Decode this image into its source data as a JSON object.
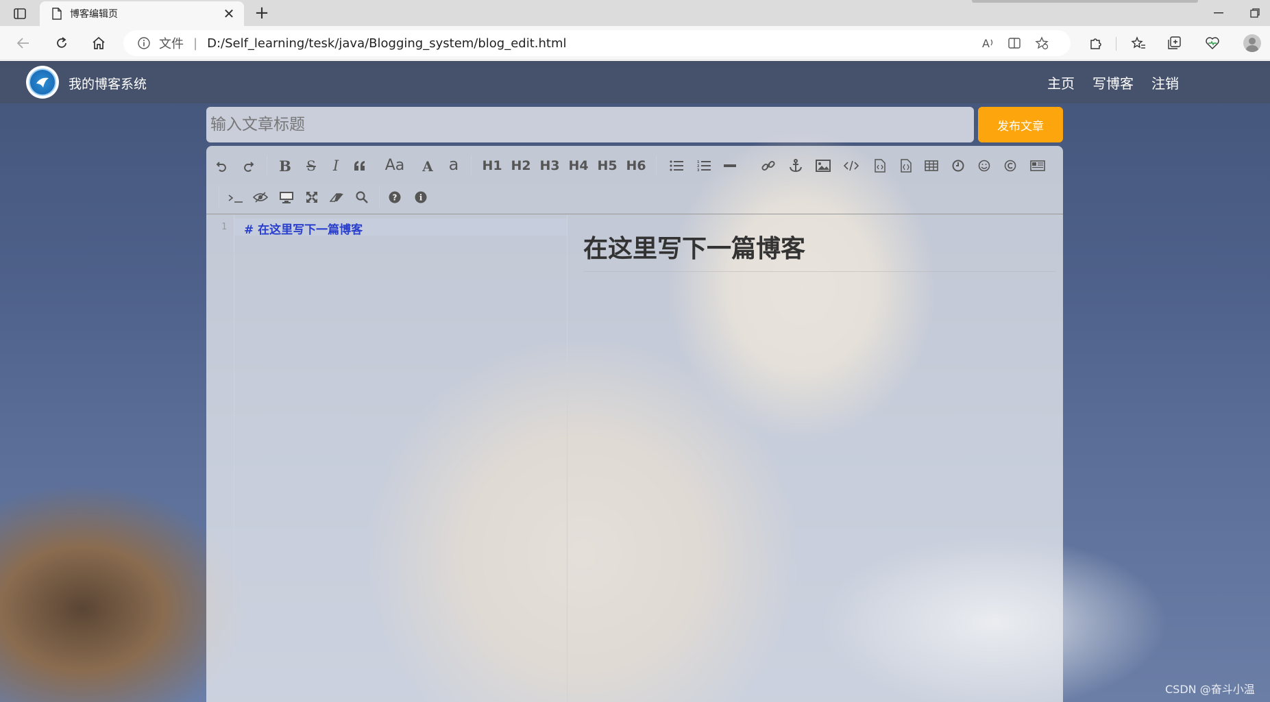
{
  "browser": {
    "tab_title": "博客编辑页",
    "tab_close": "✕",
    "new_tab": "+",
    "address": {
      "file_label": "文件",
      "separator": "|",
      "url": "D:/Self_learning/tesk/java/Blogging_system/blog_edit.html"
    }
  },
  "site": {
    "title": "我的博客系统",
    "nav": [
      "主页",
      "写博客",
      "注销"
    ]
  },
  "editor": {
    "title_placeholder": "输入文章标题",
    "publish_label": "发布文章",
    "toolbar": {
      "headings": [
        "H1",
        "H2",
        "H3",
        "H4",
        "H5",
        "H6"
      ],
      "font_case": "Aa",
      "font_upper": "A",
      "font_lower": "a",
      "bold": "B",
      "italic": "I",
      "strike": "S"
    },
    "line_numbers": [
      "1"
    ],
    "code_lines": [
      "#  在这里写下一篇博客"
    ],
    "preview_heading": "在这里写下一篇博客"
  },
  "watermark": "CSDN @奋斗小温",
  "colors": {
    "publish_button": "#fca50d",
    "markdown_heading": "#2a3fcb",
    "nav_bar": "rgba(70,80,100,0.65)"
  }
}
